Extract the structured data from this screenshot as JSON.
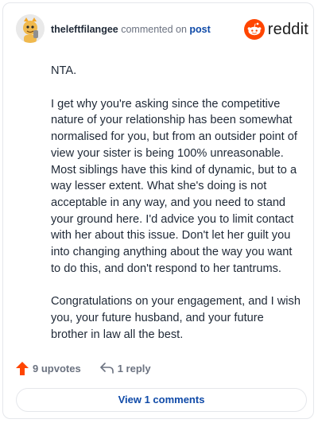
{
  "comment": {
    "author": "theleftfilangee",
    "action_text": "commented on",
    "target_link": "post",
    "paragraphs": [
      "NTA.",
      "I get why you're asking since the competitive nature of your relationship has been somewhat normalised for you, but from an outsider point of view your sister is being 100% unreasonable. Most siblings have this kind of dynamic, but to a way lesser extent. What she's doing is not acceptable in any way, and you need to stand your ground here. I'd advice you to limit contact with her about this issue. Don't let her guilt you into changing anything about the way you want to do this, and don't respond to her tantrums.",
      "Congratulations on your engagement, and I wish you, your future husband, and your future brother in law all the best."
    ]
  },
  "brand": {
    "wordmark": "reddit",
    "color": "#ff4500"
  },
  "actions": {
    "upvotes_label": "9 upvotes",
    "reply_label": "1 reply",
    "view_comments_label": "View 1 comments"
  },
  "icons": {
    "upvote": "upvote-arrow-icon",
    "reply": "reply-arrow-icon",
    "logo": "reddit-alien-icon"
  },
  "colors": {
    "link": "#0f4aa8",
    "upvote": "#ff4500",
    "muted": "#6b7280"
  }
}
